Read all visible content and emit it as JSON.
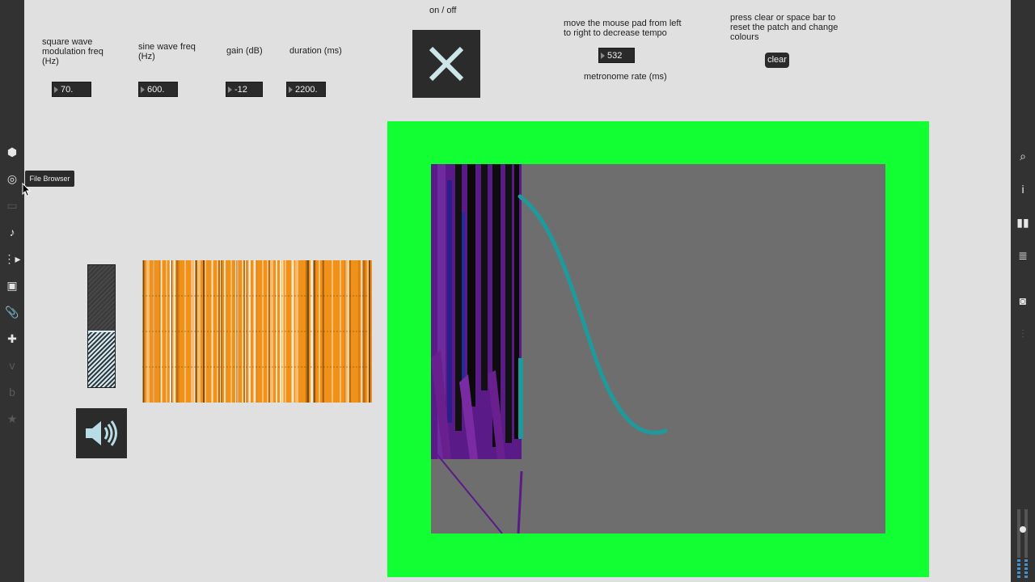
{
  "tooltip": {
    "text": "File Browser"
  },
  "left_sidebar": {
    "icons": [
      {
        "name": "cube-icon",
        "glyph": "⬢",
        "active": true
      },
      {
        "name": "file-browser-icon",
        "glyph": "◎",
        "active": true
      },
      {
        "name": "monitor-icon",
        "glyph": "▭",
        "active": false
      },
      {
        "name": "music-note-icon",
        "glyph": "♪",
        "active": true
      },
      {
        "name": "sequence-icon",
        "glyph": "⋮▸",
        "active": true
      },
      {
        "name": "image-icon",
        "glyph": "▣",
        "active": true
      },
      {
        "name": "paperclip-icon",
        "glyph": "📎",
        "active": true
      },
      {
        "name": "plug-icon",
        "glyph": "✚",
        "active": true
      },
      {
        "name": "v-package-icon",
        "glyph": "v",
        "active": false
      },
      {
        "name": "b-package-icon",
        "glyph": "b",
        "active": false
      },
      {
        "name": "star-icon",
        "glyph": "★",
        "active": false
      }
    ]
  },
  "right_sidebar": {
    "icons": [
      {
        "name": "search-icon",
        "glyph": "⌕",
        "active": true
      },
      {
        "name": "info-icon",
        "glyph": "i",
        "active": true
      },
      {
        "name": "reference-icon",
        "glyph": "▮▮",
        "active": true
      },
      {
        "name": "list-icon",
        "glyph": "≣",
        "active": true
      },
      {
        "name": "snapshot-icon",
        "glyph": "◙",
        "active": true
      },
      {
        "name": "mixer-icon",
        "glyph": "⫶",
        "active": false
      }
    ]
  },
  "controls": {
    "square_wave": {
      "label": "square wave modulation freq (Hz)",
      "value": "70."
    },
    "sine_wave": {
      "label": "sine wave freq (Hz)",
      "value": "600."
    },
    "gain": {
      "label": "gain (dB)",
      "value": "-12"
    },
    "duration": {
      "label": "duration (ms)",
      "value": "2200."
    },
    "toggle": {
      "label": "on / off",
      "state": "on"
    },
    "metronome": {
      "instruction": "move the mouse pad from left to right to decrease tempo",
      "value": "532",
      "label": "metronome rate (ms)"
    },
    "clear": {
      "instruction": "press clear or space bar to reset the patch and change colours",
      "button_label": "clear"
    }
  },
  "meter": {
    "level": 0.45
  },
  "colors": {
    "accent_orange": "#f0921a",
    "video_border": "#12ff33",
    "video_bg": "#6e6e6e",
    "teal_curve": "#1e9a9c",
    "purple": "#6a1f8e"
  }
}
